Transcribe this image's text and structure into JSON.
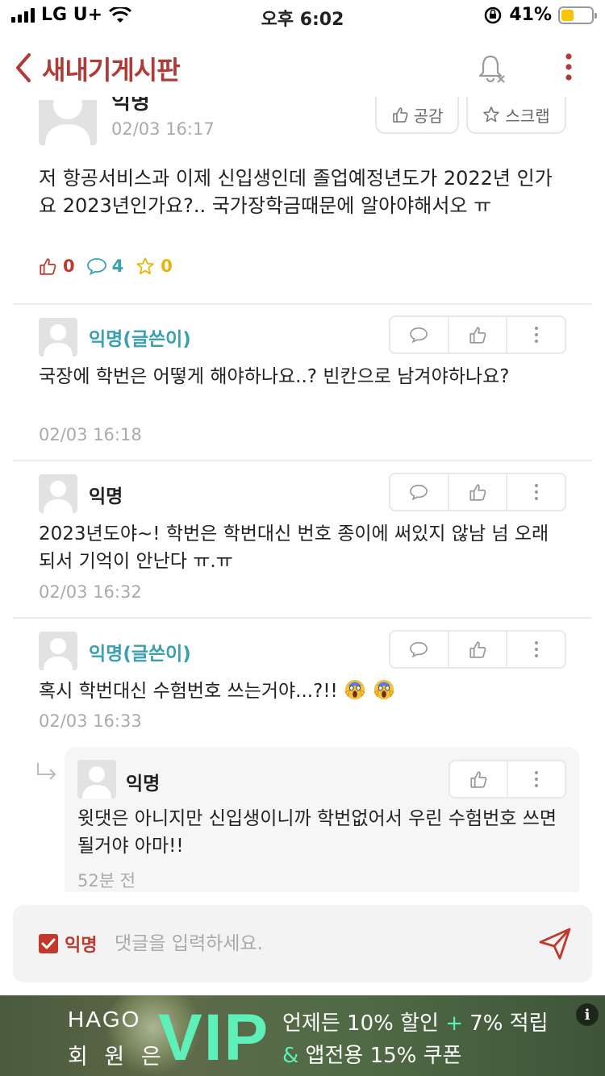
{
  "status_bar": {
    "carrier": "LG U+",
    "time": "오후 6:02",
    "battery": "41%",
    "battery_level": 0.41
  },
  "header": {
    "title": "새내기게시판"
  },
  "post": {
    "author_name_partial": "익명",
    "date": "02/03 16:17",
    "like_label": "공감",
    "scrap_label": "스크랩",
    "body": "저 항공서비스과 이제 신입생인데 졸업예정년도가 2022년 인가요 2023년인가요?.. 국가장학금때문에 알아야해서오 ㅠ",
    "stats": {
      "likes": "0",
      "comments": "4",
      "scraps": "0"
    }
  },
  "comments": [
    {
      "name": "익명(글쓴이)",
      "is_writer": true,
      "text": "국장에 학번은 어떻게 해야하나요..? 빈칸으로 남겨야하나요?",
      "time": "02/03 16:18"
    },
    {
      "name": "익명",
      "is_writer": false,
      "text": "2023년도야~! 학번은 학번대신 번호 종이에 써있지 않남 넘 오래되서 기억이 안난다 ㅠ.ㅠ",
      "time": "02/03 16:32"
    },
    {
      "name": "익명(글쓴이)",
      "is_writer": true,
      "text": "혹시 학번대신 수험번호 쓰는거야...?!!",
      "emoji": "scream-emoji",
      "time": "02/03 16:33"
    }
  ],
  "reply": {
    "name": "익명",
    "text": "윗댓은 아니지만 신입생이니까 학번없어서 우린 수험번호 쓰면될거야 아마!!",
    "time": "52분 전"
  },
  "comment_input": {
    "anon_label": "익명",
    "placeholder": "댓글을 입력하세요."
  },
  "ad": {
    "brand": "HAGO",
    "member_label": "회 원 은",
    "vip": "VIP",
    "line1_a": "언제든 10% 할인 ",
    "line1_plus": "+",
    "line1_b": " 7% 적립",
    "line2_amp": "&",
    "line2_b": " 앱전용 15% 쿠폰",
    "info_icon": "i"
  },
  "colors": {
    "accent": "#b23a36",
    "writer": "#3aa0b0",
    "vip": "#5ef0b8"
  }
}
